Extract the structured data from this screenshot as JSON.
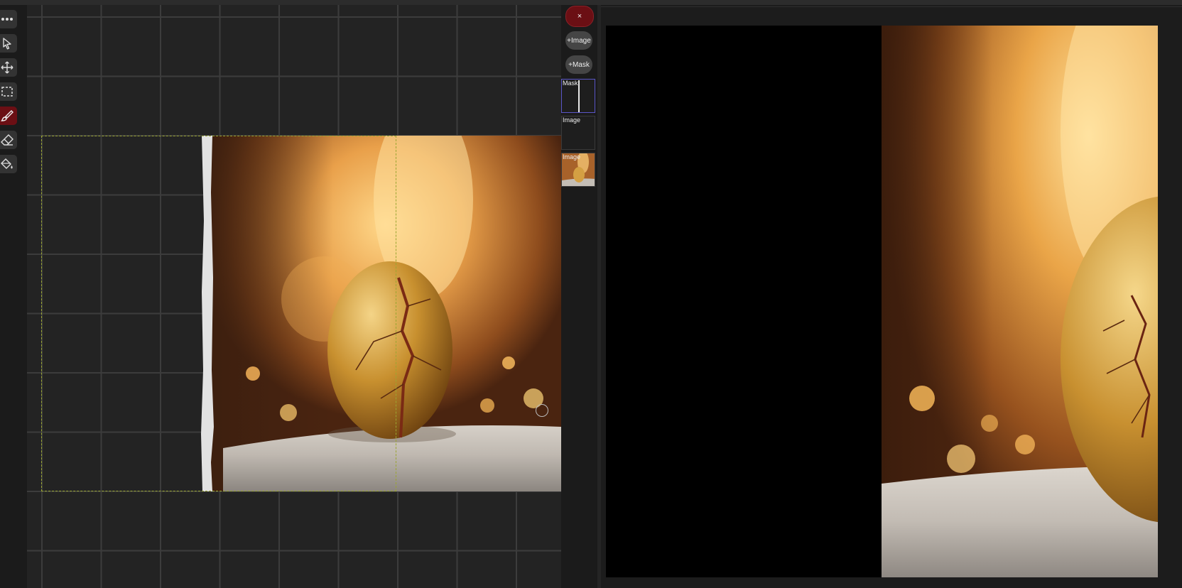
{
  "toolbar": {
    "tools": [
      {
        "name": "more-icon",
        "active": false
      },
      {
        "name": "select-icon",
        "active": false
      },
      {
        "name": "move-icon",
        "active": false
      },
      {
        "name": "marquee-icon",
        "active": false
      },
      {
        "name": "brush-icon",
        "active": true
      },
      {
        "name": "eraser-icon",
        "active": false
      },
      {
        "name": "fill-icon",
        "active": false
      }
    ]
  },
  "layers_panel": {
    "close_label": "×",
    "add_image_label": "+Image",
    "add_mask_label": "+Mask",
    "layers": [
      {
        "label": "Mask",
        "selected": true
      },
      {
        "label": "Image",
        "selected": false
      },
      {
        "label": "Image",
        "selected": false
      }
    ]
  },
  "colors": {
    "accent_red": "#6b0f14",
    "selection_dash": "#9aa632",
    "layer_selected": "#5a56c8"
  }
}
